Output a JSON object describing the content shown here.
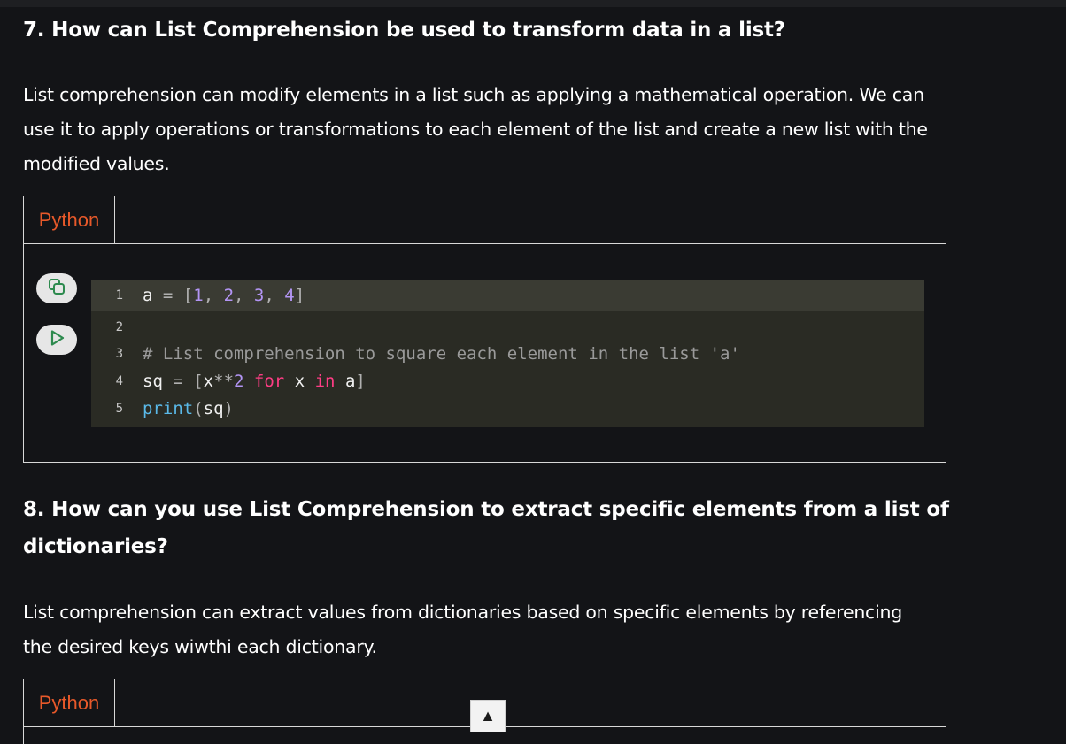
{
  "section7": {
    "heading": "7. How can List Comprehension be used to transform data in a list?",
    "paragraph": "List comprehension can modify elements in a list such as applying a mathematical operation. We can use it to apply operations or transformations to each element of the list and create a new list with the modified values.",
    "code_tab": "Python",
    "code": {
      "line_numbers": [
        "1",
        "2",
        "3",
        "4",
        "5"
      ],
      "line1": {
        "var": "a",
        "eq": " = ",
        "open": "[",
        "n1": "1",
        "c1": ", ",
        "n2": "2",
        "c2": ", ",
        "n3": "3",
        "c3": ", ",
        "n4": "4",
        "close": "]"
      },
      "line3": {
        "comment": "# List comprehension to square each element in the list 'a'"
      },
      "line4": {
        "var": "sq",
        "eq": " = ",
        "open": "[",
        "x": "x",
        "op": "**",
        "two": "2",
        "sp1": " ",
        "for": "for",
        "sp2": " ",
        "x2": "x",
        "sp3": " ",
        "in": "in",
        "sp4": " ",
        "a": "a",
        "close": "]"
      },
      "line5": {
        "fn": "print",
        "open": "(",
        "arg": "sq",
        "close": ")"
      }
    },
    "buttons": {
      "copy_icon": "copy-icon",
      "run_icon": "play-icon"
    }
  },
  "section8": {
    "heading": "8. How can you use List Comprehension to extract specific elements from a list of dictionaries?",
    "paragraph": "List comprehension can extract values from dictionaries based on specific elements by referencing the desired keys wiwthi each dictionary.",
    "code_tab": "Python"
  },
  "scroll_button": {
    "glyph": "▲",
    "icon": "arrow-up-icon"
  },
  "colors": {
    "background": "#131417",
    "tab_text": "#e8592a",
    "editor_bg": "#2a2b24",
    "keyword": "#ff3d85",
    "number": "#b395f5",
    "function": "#5ab9e8"
  }
}
